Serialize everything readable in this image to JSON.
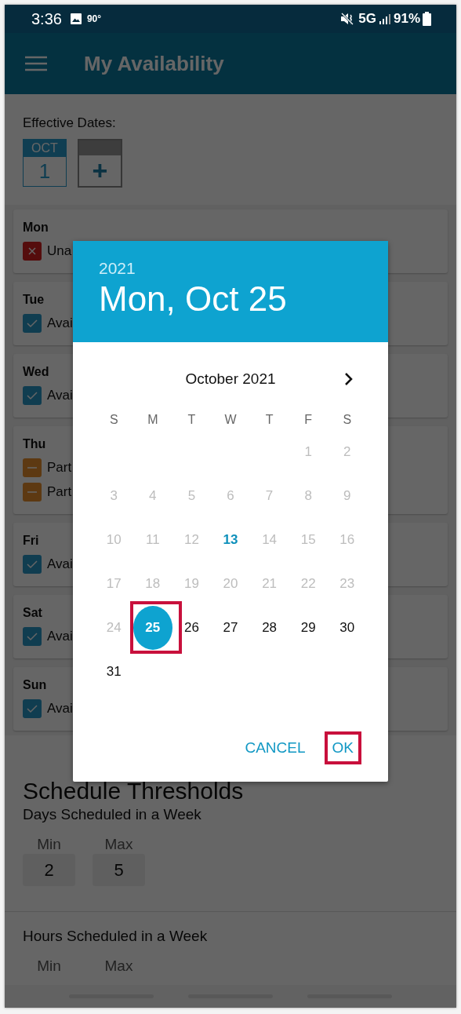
{
  "status_bar": {
    "time": "3:36",
    "temperature": "90°",
    "network": "5G",
    "battery": "91%"
  },
  "app_bar": {
    "title": "My Availability"
  },
  "effective_dates": {
    "label": "Effective Dates:",
    "dates": [
      {
        "month": "OCT",
        "day": "1"
      }
    ],
    "add_button": "+"
  },
  "days": [
    {
      "name": "Mon",
      "statuses": [
        {
          "kind": "unavailable",
          "label": "Una"
        }
      ]
    },
    {
      "name": "Tue",
      "statuses": [
        {
          "kind": "available",
          "label": "Avai"
        }
      ]
    },
    {
      "name": "Wed",
      "statuses": [
        {
          "kind": "available",
          "label": "Avai"
        }
      ]
    },
    {
      "name": "Thu",
      "statuses": [
        {
          "kind": "partial",
          "label": "Part"
        },
        {
          "kind": "partial",
          "label": "Part"
        }
      ]
    },
    {
      "name": "Fri",
      "statuses": [
        {
          "kind": "available",
          "label": "Avai"
        }
      ]
    },
    {
      "name": "Sat",
      "statuses": [
        {
          "kind": "available",
          "label": "Avai"
        }
      ]
    },
    {
      "name": "Sun",
      "statuses": [
        {
          "kind": "available",
          "label": "Avai"
        }
      ]
    }
  ],
  "schedule_thresholds": {
    "title": "Schedule Thresholds",
    "groups": [
      {
        "title": "Days Scheduled in a Week",
        "fields": [
          {
            "label": "Min",
            "value": "2"
          },
          {
            "label": "Max",
            "value": "5"
          }
        ]
      },
      {
        "title": "Hours Scheduled in a Week",
        "fields": [
          {
            "label": "Min"
          },
          {
            "label": "Max"
          }
        ]
      }
    ]
  },
  "date_picker": {
    "year": "2021",
    "date": "Mon, Oct 25",
    "month": "October 2021",
    "weekdays": [
      "S",
      "M",
      "T",
      "W",
      "T",
      "F",
      "S"
    ],
    "weeks": [
      [
        {
          "kind": "blank"
        },
        {
          "kind": "blank"
        },
        {
          "kind": "blank"
        },
        {
          "kind": "blank"
        },
        {
          "kind": "blank"
        },
        {
          "kind": "day",
          "label": "1",
          "disabled": true,
          "today": false,
          "selected": false,
          "highlighted": false
        },
        {
          "kind": "day",
          "label": "2",
          "disabled": true,
          "today": false,
          "selected": false,
          "highlighted": false
        }
      ],
      [
        {
          "kind": "day",
          "label": "3",
          "disabled": true,
          "today": false,
          "selected": false,
          "highlighted": false
        },
        {
          "kind": "day",
          "label": "4",
          "disabled": true,
          "today": false,
          "selected": false,
          "highlighted": false
        },
        {
          "kind": "day",
          "label": "5",
          "disabled": true,
          "today": false,
          "selected": false,
          "highlighted": false
        },
        {
          "kind": "day",
          "label": "6",
          "disabled": true,
          "today": false,
          "selected": false,
          "highlighted": false
        },
        {
          "kind": "day",
          "label": "7",
          "disabled": true,
          "today": false,
          "selected": false,
          "highlighted": false
        },
        {
          "kind": "day",
          "label": "8",
          "disabled": true,
          "today": false,
          "selected": false,
          "highlighted": false
        },
        {
          "kind": "day",
          "label": "9",
          "disabled": true,
          "today": false,
          "selected": false,
          "highlighted": false
        }
      ],
      [
        {
          "kind": "day",
          "label": "10",
          "disabled": true,
          "today": false,
          "selected": false,
          "highlighted": false
        },
        {
          "kind": "day",
          "label": "11",
          "disabled": true,
          "today": false,
          "selected": false,
          "highlighted": false
        },
        {
          "kind": "day",
          "label": "12",
          "disabled": true,
          "today": false,
          "selected": false,
          "highlighted": false
        },
        {
          "kind": "day",
          "label": "13",
          "disabled": false,
          "today": true,
          "selected": false,
          "highlighted": false
        },
        {
          "kind": "day",
          "label": "14",
          "disabled": true,
          "today": false,
          "selected": false,
          "highlighted": false
        },
        {
          "kind": "day",
          "label": "15",
          "disabled": true,
          "today": false,
          "selected": false,
          "highlighted": false
        },
        {
          "kind": "day",
          "label": "16",
          "disabled": true,
          "today": false,
          "selected": false,
          "highlighted": false
        }
      ],
      [
        {
          "kind": "day",
          "label": "17",
          "disabled": true,
          "today": false,
          "selected": false,
          "highlighted": false
        },
        {
          "kind": "day",
          "label": "18",
          "disabled": true,
          "today": false,
          "selected": false,
          "highlighted": false
        },
        {
          "kind": "day",
          "label": "19",
          "disabled": true,
          "today": false,
          "selected": false,
          "highlighted": false
        },
        {
          "kind": "day",
          "label": "20",
          "disabled": true,
          "today": false,
          "selected": false,
          "highlighted": false
        },
        {
          "kind": "day",
          "label": "21",
          "disabled": true,
          "today": false,
          "selected": false,
          "highlighted": false
        },
        {
          "kind": "day",
          "label": "22",
          "disabled": true,
          "today": false,
          "selected": false,
          "highlighted": false
        },
        {
          "kind": "day",
          "label": "23",
          "disabled": true,
          "today": false,
          "selected": false,
          "highlighted": false
        }
      ],
      [
        {
          "kind": "day",
          "label": "24",
          "disabled": true,
          "today": false,
          "selected": false,
          "highlighted": false
        },
        {
          "kind": "day",
          "label": "25",
          "disabled": false,
          "today": false,
          "selected": true,
          "highlighted": true
        },
        {
          "kind": "day",
          "label": "26",
          "disabled": false,
          "today": false,
          "selected": false,
          "highlighted": false
        },
        {
          "kind": "day",
          "label": "27",
          "disabled": false,
          "today": false,
          "selected": false,
          "highlighted": false
        },
        {
          "kind": "day",
          "label": "28",
          "disabled": false,
          "today": false,
          "selected": false,
          "highlighted": false
        },
        {
          "kind": "day",
          "label": "29",
          "disabled": false,
          "today": false,
          "selected": false,
          "highlighted": false
        },
        {
          "kind": "day",
          "label": "30",
          "disabled": false,
          "today": false,
          "selected": false,
          "highlighted": false
        }
      ],
      [
        {
          "kind": "day",
          "label": "31",
          "disabled": false,
          "today": false,
          "selected": false,
          "highlighted": false
        }
      ]
    ],
    "buttons": [
      {
        "label": "CANCEL",
        "highlighted": false
      },
      {
        "label": "OK",
        "highlighted": true
      }
    ]
  }
}
